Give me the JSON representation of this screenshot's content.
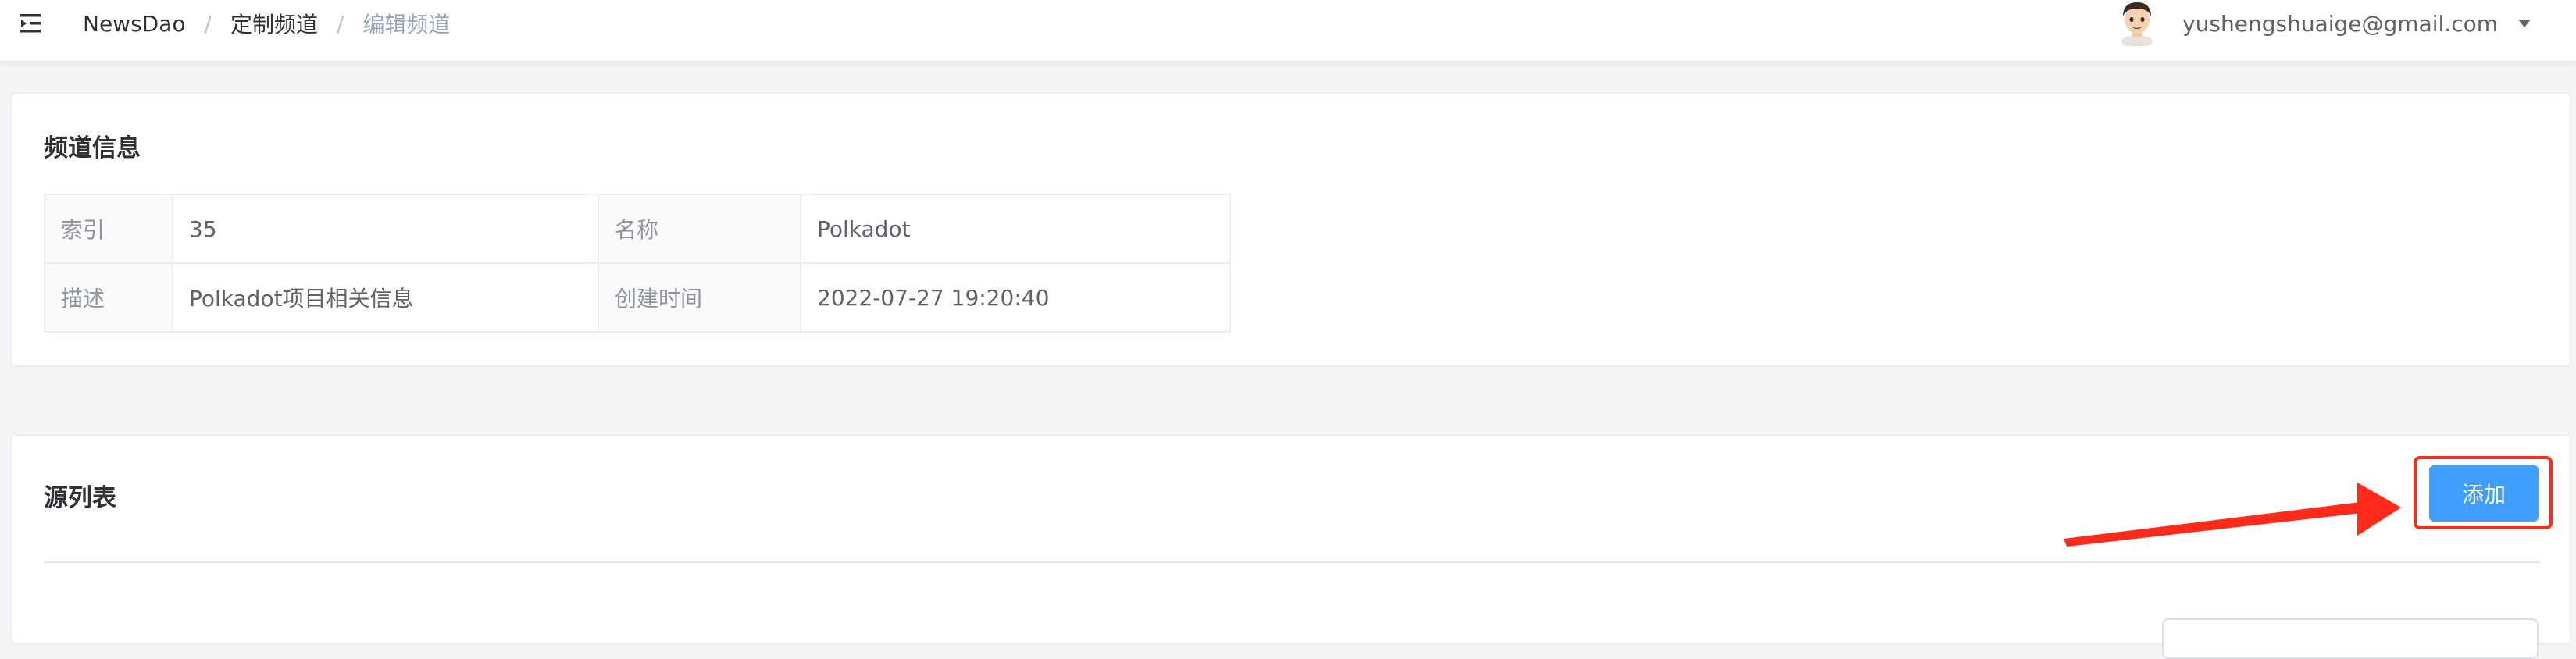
{
  "breadcrumb": {
    "home": "NewsDao",
    "parent": "定制频道",
    "current": "编辑频道",
    "separator": "/"
  },
  "user": {
    "email": "yushengshuaige@gmail.com"
  },
  "channel_info": {
    "title": "频道信息",
    "rows": [
      {
        "label1": "索引",
        "value1": "35",
        "label2": "名称",
        "value2": "Polkadot"
      },
      {
        "label1": "描述",
        "value1": "Polkadot项目相关信息",
        "label2": "创建时间",
        "value2": "2022-07-27 19:20:40"
      }
    ]
  },
  "source_list": {
    "title": "源列表",
    "add_label": "添加"
  },
  "colors": {
    "primary": "#409eff",
    "highlight": "#ff2a1a"
  },
  "icons": {
    "menu": "hamburger-menu-icon",
    "dropdown": "caret-down-icon",
    "avatar": "user-avatar"
  }
}
